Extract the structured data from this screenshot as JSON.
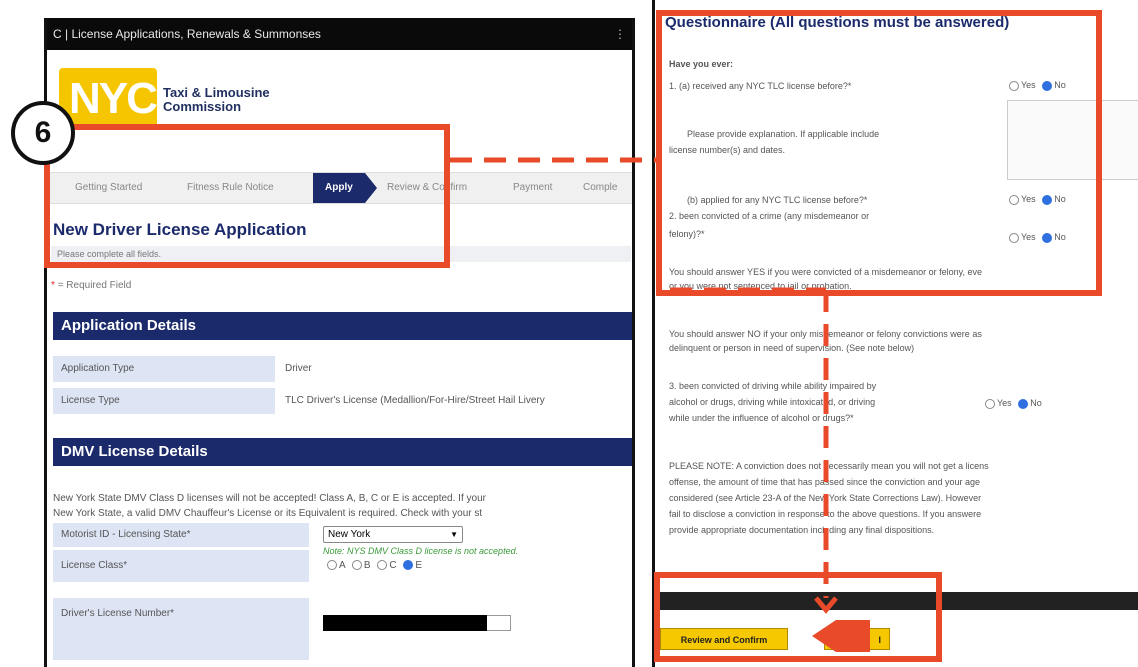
{
  "left": {
    "window_title": "C | License Applications, Renewals & Summonses",
    "logo_text": "NYC",
    "logo_line1": "Taxi & Limousine",
    "logo_line2": "Commission",
    "steps": [
      "Getting Started",
      "Fitness Rule Notice",
      "Apply",
      "Review & Confirm",
      "Payment",
      "Comple"
    ],
    "active_step": "Apply",
    "page_title": "New Driver License Application",
    "subtitle": "Please complete all fields.",
    "required_note": "= Required Field",
    "required_star": "*",
    "app_details_header": "Application Details",
    "app_rows": [
      {
        "label": "Application Type",
        "value": "Driver"
      },
      {
        "label": "License Type",
        "value": "TLC Driver's License (Medallion/For-Hire/Street Hail Livery"
      }
    ],
    "dmv_header": "DMV License Details",
    "dmv_text_1": "New York State DMV Class D licenses will not be accepted! Class A, B, C or E is accepted. If your",
    "dmv_text_2": "New York State, a valid DMV Chauffeur's License or its Equivalent is required. Check with your st",
    "motorist_label": "Motorist ID - Licensing State*",
    "state_value": "New York",
    "class_note": "Note: NYS DMV Class D license is not accepted.",
    "license_class_label": "License Class*",
    "classes": [
      "A",
      "B",
      "C",
      "E"
    ],
    "selected_class": "E",
    "dl_number_label": "Driver's License Number*",
    "step_badge": "6"
  },
  "right": {
    "title": "Questionnaire (All questions must be answered)",
    "have_you_ever": "Have you ever:",
    "q1a": "1. (a) received any NYC TLC license before?*",
    "explain_1": "Please provide explanation. If applicable    include",
    "explain_2": "license number(s) and dates.",
    "q1b": "(b) applied for any NYC TLC license before?*",
    "q2_1": "2. been convicted of a crime (any misdemeanor or",
    "q2_2": "felony)?*",
    "yes_note_1": "You should answer YES if you were convicted of a misdemeanor or felony, eve",
    "yes_note_2": "or you were not sentenced to jail or probation.",
    "no_note_1": "You should answer NO if your only misdemeanor or felony convictions were as",
    "no_note_2": "delinquent or person in need of supervision. (See note below)",
    "q3_1": "3. been convicted of driving while ability impaired by",
    "q3_2": "alcohol or drugs, driving while intoxicated, or driving",
    "q3_3": "while under the influence of alcohol or drugs?*",
    "please_note": [
      "PLEASE NOTE: A conviction does not necessarily mean you will not get a licens",
      "offense, the amount of time that has passed since the conviction and your age",
      "considered (see Article 23-A of the New York State Corrections Law). However",
      "fail to disclose a conviction in response to the above questions. If you answere",
      "provide appropriate documentation including any final dispositions."
    ],
    "yes": "Yes",
    "no": "No",
    "review_button": "Review and Confirm",
    "second_button": "l"
  },
  "colors": {
    "accent": "#e84a2a",
    "header": "#1b2a6b",
    "button": "#f5c800"
  }
}
